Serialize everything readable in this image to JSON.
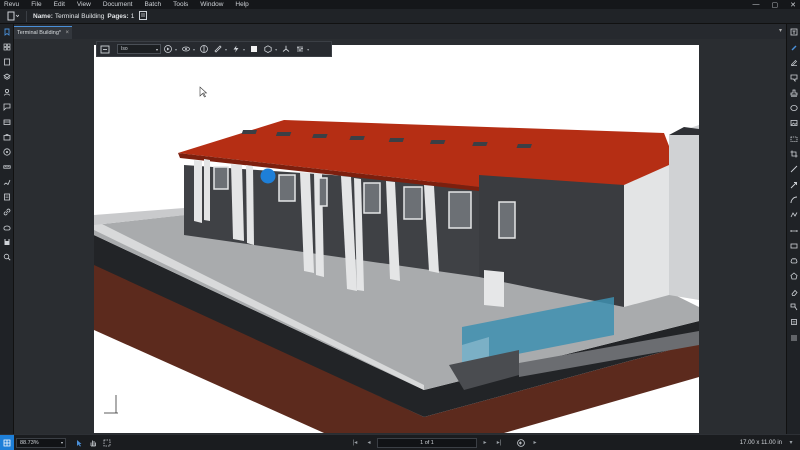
{
  "menu": {
    "items": [
      "Revu",
      "File",
      "Edit",
      "View",
      "Document",
      "Batch",
      "Tools",
      "Window",
      "Help"
    ]
  },
  "window_controls": {
    "minimize": "—",
    "maximize": "▢",
    "close": "✕"
  },
  "properties": {
    "name_label": "Name:",
    "name_value": "Terminal Building",
    "pages_label": "Pages:",
    "pages_value": "1"
  },
  "tabs": {
    "active_label": "Terminal Building*",
    "close_glyph": "×",
    "dropdown_glyph": "▾"
  },
  "toolbar3d": {
    "view_value": "Iso",
    "caret": "▾"
  },
  "status": {
    "zoom_value": "88.73%",
    "page_indicator": "1 of 1",
    "page_size": "17.00 x 11.00 in",
    "caret": "▾"
  },
  "colors": {
    "accent": "#4a90d9",
    "roof": "#b52e14",
    "wall_dark": "#3f4145",
    "slab": "#a9abad",
    "soil": "#5c2a1d",
    "glass": "#3e8fb0",
    "cursor_dot": "#1e7fd8"
  },
  "icons": {
    "left_panel": [
      "bookmarks-icon",
      "thumbnails-icon",
      "file-access-icon",
      "layers-icon",
      "model-tree-icon",
      "markups-list-icon",
      "spaces-icon",
      "tool-chest-icon",
      "properties-icon",
      "measurements-icon",
      "signatures-icon",
      "forms-icon",
      "links-icon",
      "studio-icon",
      "save-icon",
      "search-icon"
    ],
    "right_panel": [
      "text-box-icon",
      "pen-icon",
      "highlight-icon",
      "note-icon",
      "stamp-icon",
      "ellipse-icon",
      "image-icon",
      "snapshot-icon",
      "crop-icon",
      "line-icon",
      "arrow-icon",
      "arc-icon",
      "polyline-icon",
      "dimension-icon",
      "rectangle-icon",
      "cloud-icon",
      "polygon-icon",
      "eraser-icon",
      "callout-icon",
      "stamp2-icon",
      "more-icon"
    ]
  }
}
